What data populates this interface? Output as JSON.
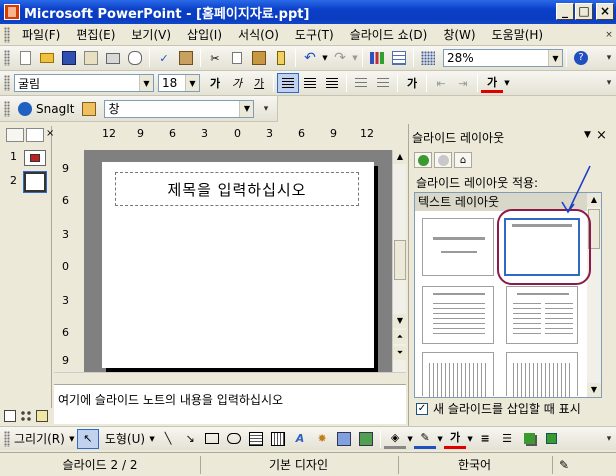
{
  "window": {
    "title": "Microsoft PowerPoint - [홈페이지자료.ppt]",
    "min_label": "_",
    "max_label": "□",
    "close_label": "×"
  },
  "menu": {
    "items": [
      "파일(F)",
      "편집(E)",
      "보기(V)",
      "삽입(I)",
      "서식(O)",
      "도구(T)",
      "슬라이드 쇼(D)",
      "창(W)",
      "도움말(H)"
    ]
  },
  "standard_toolbar": {
    "zoom": "28%"
  },
  "format_toolbar": {
    "font_name": "굴림",
    "font_size": "18",
    "bold_label": "가",
    "italic_label": "가",
    "underline_label": "가",
    "font_color_label": "가"
  },
  "snagit_toolbar": {
    "snagit_label": "SnagIt",
    "window_label": "창"
  },
  "thumbnails": [
    {
      "number": "1"
    },
    {
      "number": "2"
    }
  ],
  "ruler_h": [
    "12",
    "9",
    "6",
    "3",
    "0",
    "3",
    "6",
    "9",
    "12"
  ],
  "ruler_v": [
    "9",
    "6",
    "3",
    "0",
    "3",
    "6",
    "9"
  ],
  "slide": {
    "title_placeholder": "제목을 입력하십시오"
  },
  "notes": {
    "placeholder": "여기에 슬라이드 노트의 내용을 입력하십시오"
  },
  "task_pane": {
    "title": "슬라이드 레이아웃",
    "apply_label": "슬라이드 레이아웃 적용:",
    "section_label": "텍스트 레이아웃",
    "insert_checkbox_label": "새 슬라이드를 삽입할 때 표시",
    "insert_checkbox_checked": true
  },
  "drawing_toolbar": {
    "draw_label": "그리기(R)",
    "autoshapes_label": "도형(U)"
  },
  "status": {
    "slide_count": "슬라이드 2 / 2",
    "design": "기본 디자인",
    "language": "한국어"
  },
  "colors": {
    "title_bar": "#0a3cc0",
    "highlight_circle": "#8b1a4a",
    "arrow": "#1a3cc8",
    "font_color_red": "#e00000"
  }
}
